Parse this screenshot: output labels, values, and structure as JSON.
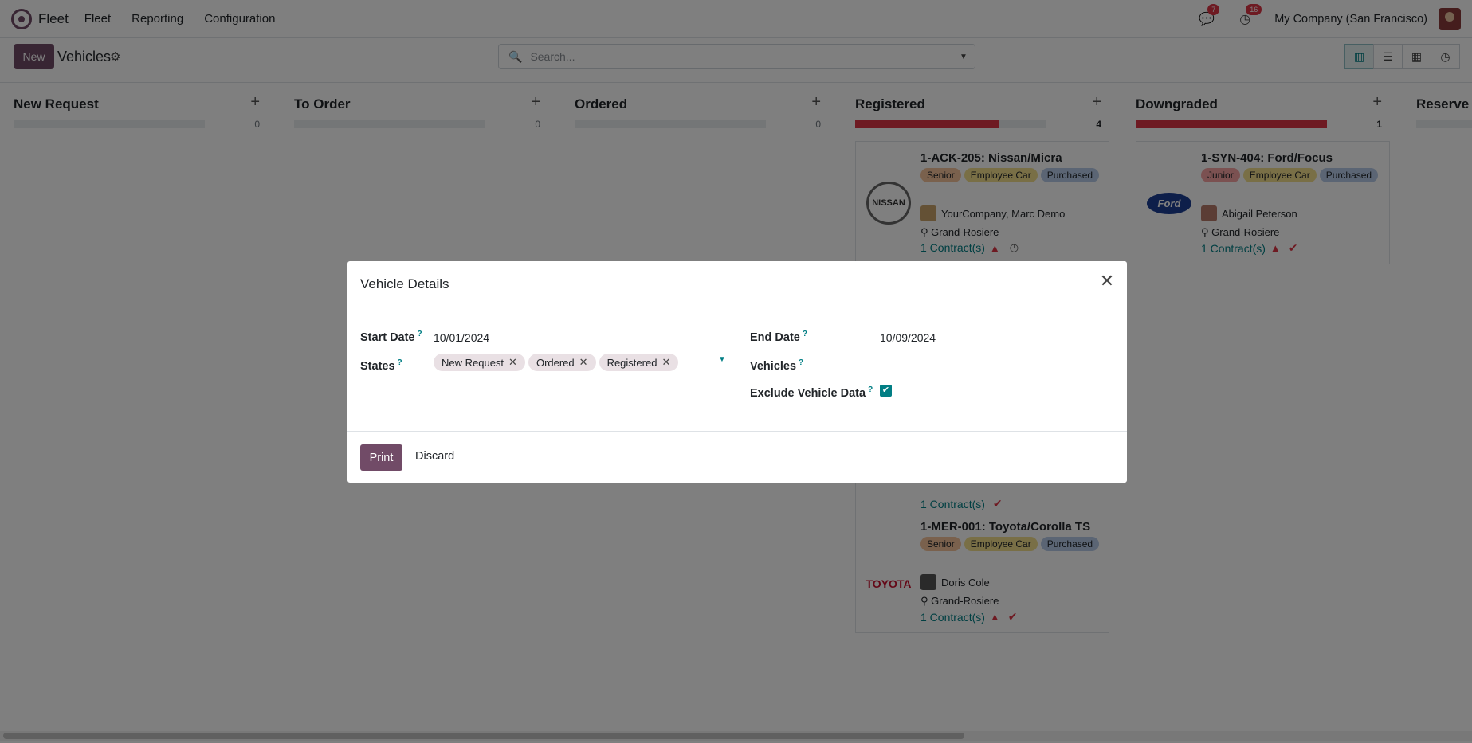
{
  "navbar": {
    "app_name": "Fleet",
    "menu": [
      "Fleet",
      "Reporting",
      "Configuration"
    ],
    "messages_count": "7",
    "activities_count": "16",
    "company": "My Company (San Francisco)"
  },
  "control_panel": {
    "new_label": "New",
    "title": "Vehicles",
    "search_placeholder": "Search..."
  },
  "kanban": {
    "columns": [
      {
        "name": "New Request",
        "count": "0",
        "progress": 0
      },
      {
        "name": "To Order",
        "count": "0",
        "progress": 0
      },
      {
        "name": "Ordered",
        "count": "0",
        "progress": 0
      },
      {
        "name": "Registered",
        "count": "4",
        "progress": 0.75
      },
      {
        "name": "Downgraded",
        "count": "1",
        "progress": 1.0
      },
      {
        "name": "Reserve",
        "count": "",
        "progress": 0
      }
    ],
    "cards": [
      {
        "title": "1-ACK-205: Nissan/Micra",
        "brand": "NISSAN",
        "tags": [
          "Senior",
          "Employee Car",
          "Purchased"
        ],
        "driver": "YourCompany, Marc Demo",
        "location": "Grand-Rosiere",
        "contracts": "1 Contract(s)"
      },
      {
        "title": "1-SYN-404: Ford/Focus",
        "brand": "Ford",
        "tags": [
          "Junior",
          "Employee Car",
          "Purchased"
        ],
        "driver": "Abigail Peterson",
        "location": "Grand-Rosiere",
        "contracts": "1 Contract(s)"
      },
      {
        "title": "",
        "brand": "",
        "tags": [],
        "driver": "",
        "location": "",
        "contracts": "1 Contract(s)"
      },
      {
        "title": "1-MER-001: Toyota/Corolla TS",
        "brand": "TOYOTA",
        "tags": [
          "Senior",
          "Employee Car",
          "Purchased"
        ],
        "driver": "Doris Cole",
        "location": "Grand-Rosiere",
        "contracts": "1 Contract(s)"
      }
    ]
  },
  "modal": {
    "title": "Vehicle Details",
    "start_date_label": "Start Date",
    "start_date_value": "10/01/2024",
    "end_date_label": "End Date",
    "end_date_value": "10/09/2024",
    "states_label": "States",
    "states": [
      "New Request",
      "Ordered",
      "Registered"
    ],
    "vehicles_label": "Vehicles",
    "exclude_label": "Exclude Vehicle Data",
    "exclude_checked": true,
    "help_marker": "?",
    "print_label": "Print",
    "discard_label": "Discard"
  }
}
